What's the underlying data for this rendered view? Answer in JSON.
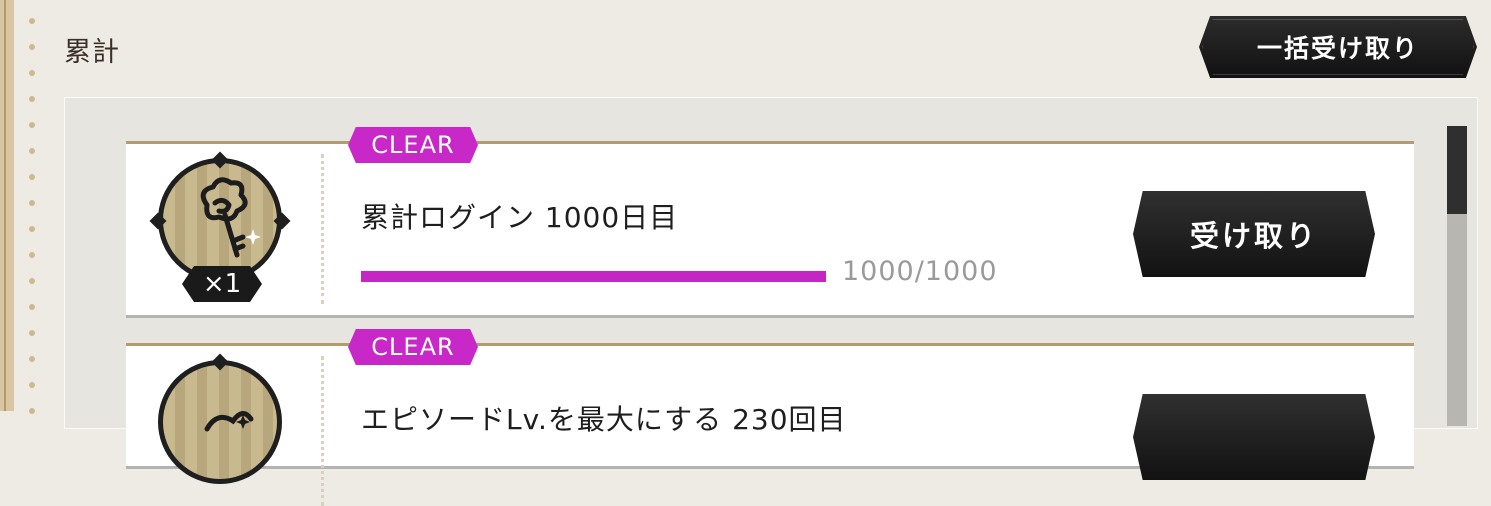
{
  "section": {
    "title": "累計"
  },
  "bulk_button": {
    "label": "一括受け取り"
  },
  "missions": [
    {
      "status_tag": "CLEAR",
      "title": "累計ログイン 1000日目",
      "quantity": "×1",
      "progress_text": "1000/1000",
      "progress_fraction": 1.0,
      "reward_icon": "key-icon",
      "button_label": "受け取り"
    },
    {
      "status_tag": "CLEAR",
      "title": "エピソードLv.を最大にする 230回目",
      "reward_icon": "reward-icon"
    }
  ],
  "colors": {
    "clear_tag": "#c928c9",
    "progress_fill": "#c426c4",
    "button_dark": "#1a1a1a",
    "card_top_border": "#b59c70"
  }
}
